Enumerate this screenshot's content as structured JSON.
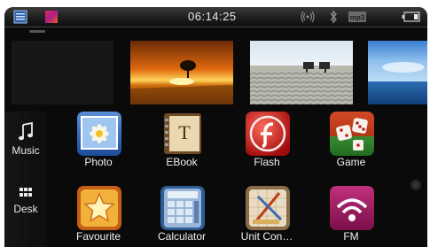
{
  "status_bar": {
    "time": "06:14:25",
    "icons": [
      "app-menu-icon",
      "color-palette-icon",
      "wireless-signal-icon",
      "bluetooth-icon",
      "mp3-icon",
      "battery-icon"
    ]
  },
  "photo_strip": [
    "empty-photo",
    "sunset-tree-photo",
    "beach-sand-photo",
    "ocean-sky-photo"
  ],
  "sidebar": {
    "items": [
      {
        "label": "Music",
        "icon": "music-note-icon"
      },
      {
        "label": "Desk",
        "icon": "desk-grid-icon"
      }
    ]
  },
  "apps": [
    {
      "label": "Photo",
      "icon": "photo-flower-icon"
    },
    {
      "label": "EBook",
      "icon": "ebook-icon"
    },
    {
      "label": "Flash",
      "icon": "flash-icon"
    },
    {
      "label": "Game",
      "icon": "dice-icon"
    },
    {
      "label": "Favourite",
      "icon": "star-icon"
    },
    {
      "label": "Calculator",
      "icon": "calculator-icon"
    },
    {
      "label": "Unit Con…",
      "icon": "ruler-icon"
    },
    {
      "label": "FM",
      "icon": "fm-radio-icon"
    }
  ]
}
